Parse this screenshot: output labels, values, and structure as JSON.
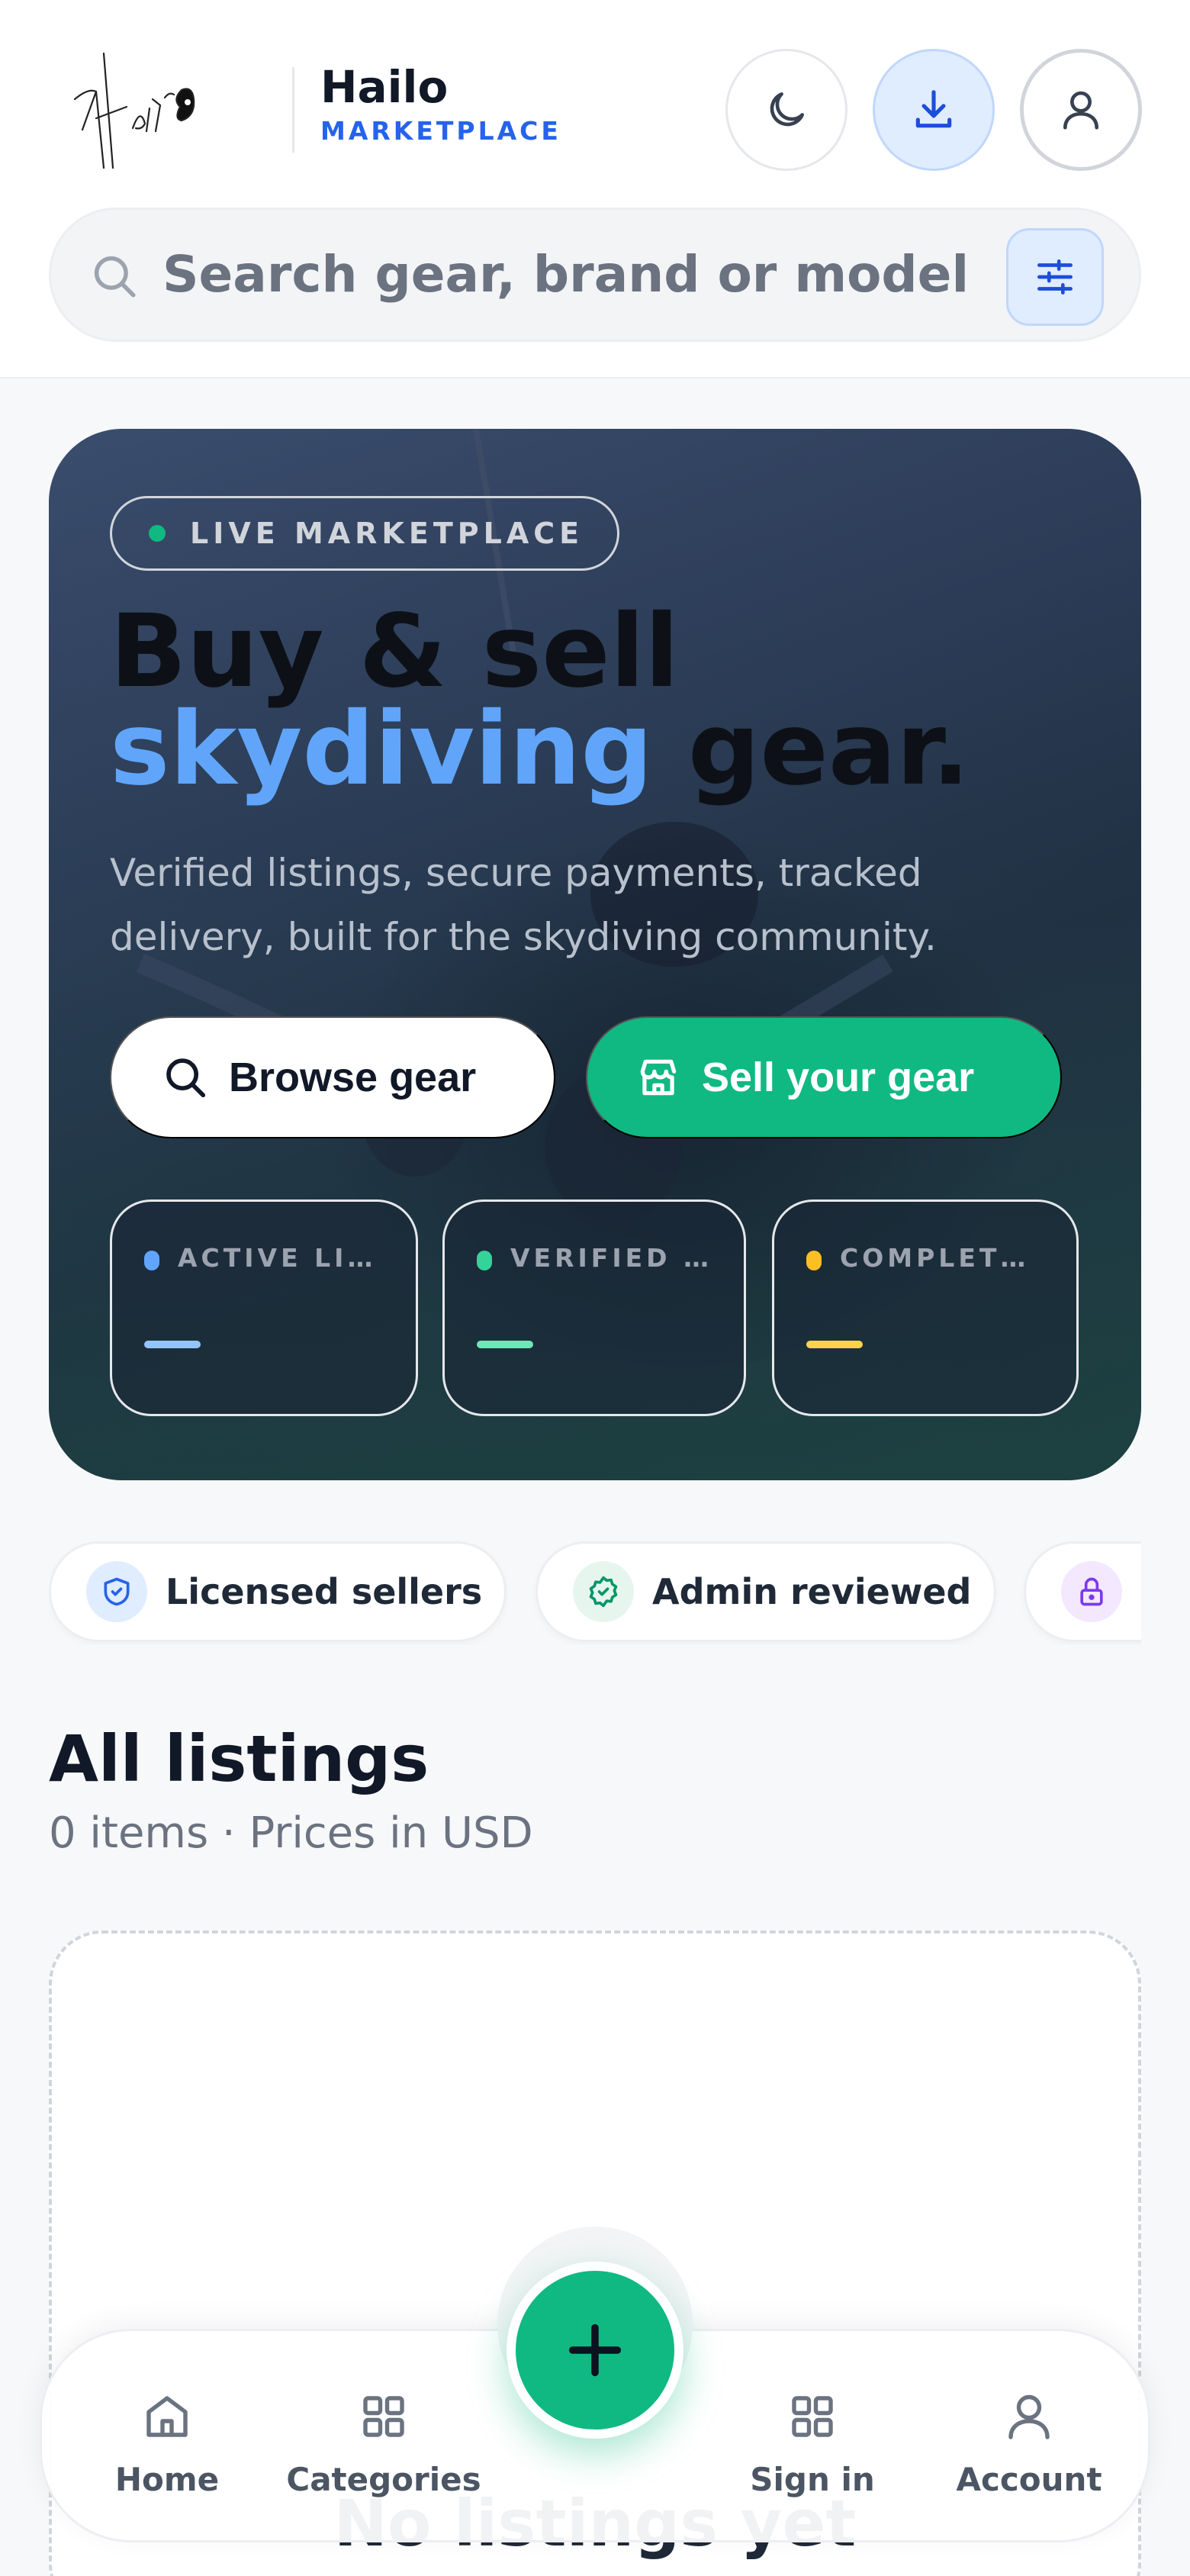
{
  "header": {
    "brand_name": "Hailo",
    "brand_sub": "MARKETPLACE",
    "icons": {
      "theme": "moon-icon",
      "download": "download-icon",
      "account": "user-icon"
    }
  },
  "search": {
    "placeholder": "Search gear, brand or model",
    "icon": "search-icon",
    "filter_icon": "sliders-icon"
  },
  "hero": {
    "badge": "LIVE MARKETPLACE",
    "title_line1": "Buy & sell",
    "title_accent": "skydiving",
    "title_rest": " gear.",
    "subtitle": "Verified listings, secure payments, tracked delivery, built for the skydiving community.",
    "browse_label": "Browse gear",
    "sell_label": "Sell your gear",
    "stats": [
      {
        "label": "ACTIVE LISTINGS",
        "value": "",
        "color": "#60a5fa"
      },
      {
        "label": "VERIFIED SELLERS",
        "value": "",
        "color": "#34d399"
      },
      {
        "label": "COMPLETED SALES",
        "value": "",
        "color": "#fbbf24"
      }
    ]
  },
  "trust_chips": [
    {
      "label": "Licensed sellers",
      "icon": "shield-check-icon",
      "color": "#2563eb"
    },
    {
      "label": "Admin reviewed",
      "icon": "badge-check-icon",
      "color": "#059669"
    },
    {
      "label": "",
      "icon": "lock-icon",
      "color": "#7c3aed"
    }
  ],
  "listings": {
    "title": "All listings",
    "summary": "0 items · Prices in USD",
    "empty_title": "No listings yet"
  },
  "bottom_nav": {
    "items": [
      {
        "label": "Home",
        "icon": "home-icon"
      },
      {
        "label": "Categories",
        "icon": "grid-icon"
      },
      {
        "label": "Sign in",
        "icon": "grid-icon"
      },
      {
        "label": "Account",
        "icon": "user-icon"
      }
    ],
    "fab_icon": "plus-icon"
  },
  "colors": {
    "accent_blue": "#2563eb",
    "accent_green": "#10b981",
    "hero_bg": "#2c3c57"
  }
}
